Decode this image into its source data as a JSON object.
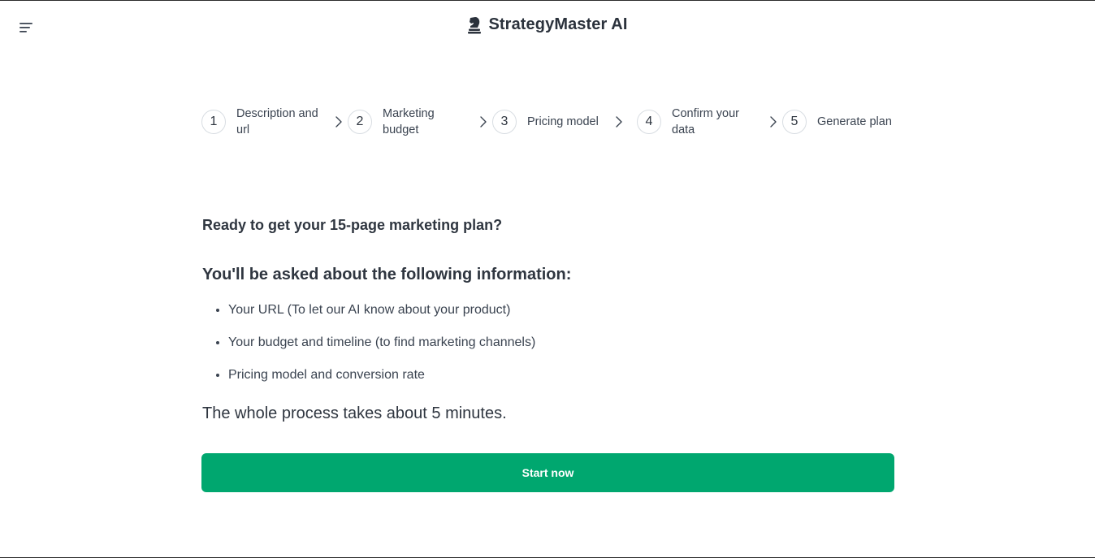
{
  "header": {
    "brand_name": "StrategyMaster AI",
    "menu_icon": "hamburger-menu-icon",
    "logo_icon": "chess-knight-icon"
  },
  "stepper": {
    "steps": [
      {
        "number": "1",
        "label": "Description and url"
      },
      {
        "number": "2",
        "label": "Marketing budget"
      },
      {
        "number": "3",
        "label": "Pricing model"
      },
      {
        "number": "4",
        "label": "Confirm your data"
      },
      {
        "number": "5",
        "label": "Generate plan"
      }
    ],
    "separator_icon": "chevron-right-icon"
  },
  "intro": {
    "heading": "Ready to get your 15-page marketing plan?",
    "subheading": "You'll be asked about the following information:",
    "items": [
      "Your URL (To let our AI know about your product)",
      "Your budget and timeline (to find marketing channels)",
      "Pricing model and conversion rate"
    ],
    "duration_text": "The whole process takes about 5 minutes."
  },
  "cta": {
    "start_label": "Start now"
  },
  "colors": {
    "accent": "#00a76f",
    "text": "#2f3640",
    "step_border": "#d8dde2"
  }
}
